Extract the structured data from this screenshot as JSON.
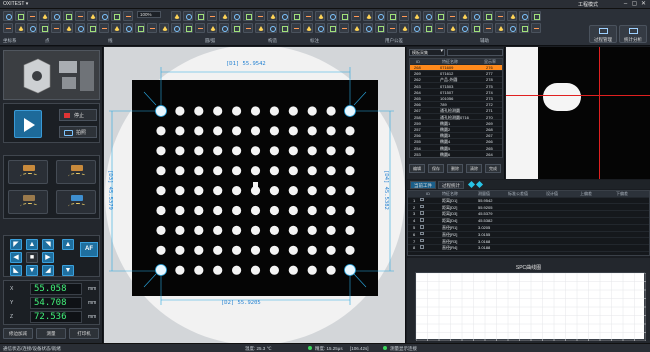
{
  "titlebar": {
    "app_name": "OXITEST ▾",
    "window_title": "工程模式",
    "minimize": "–",
    "maximize": "▢",
    "close": "✕"
  },
  "toolbar": {
    "zoom": "100%",
    "group_labels": [
      "坐标系",
      "点",
      "线",
      "圆/弧",
      "构造",
      "标注",
      "用户公差",
      "辅助"
    ],
    "process_manage": "过程管理",
    "stats_analysis": "统计分析"
  },
  "left": {
    "stop_label": "停止",
    "snapshot_label": "拍照",
    "af_label": "AF",
    "coords": [
      {
        "axis": "X",
        "value": "55.058",
        "unit": "mm"
      },
      {
        "axis": "Y",
        "value": "54.708",
        "unit": "mm"
      },
      {
        "axis": "Z",
        "value": "72.536",
        "unit": "mm"
      }
    ],
    "buttons": [
      "修边加减",
      "测量",
      "打印机"
    ]
  },
  "measurements": {
    "d1": "[D1] 55.9542",
    "d2": "[D2] 55.9205",
    "d3": "[D3] 45.5379",
    "d4": "[D4] 45.5382"
  },
  "list": {
    "combo": "模板采集",
    "headers": [
      "ID",
      "特征名称",
      "显示率"
    ],
    "rows": [
      {
        "id": "268",
        "name": "071609",
        "value": "276",
        "selected": true
      },
      {
        "id": "269",
        "name": "071612",
        "value": "277"
      },
      {
        "id": "262",
        "name": "产品-外圆",
        "value": "278"
      },
      {
        "id": "263",
        "name": "071503",
        "value": "275"
      },
      {
        "id": "264",
        "name": "071507",
        "value": "274"
      },
      {
        "id": "265",
        "name": "101056",
        "value": "273"
      },
      {
        "id": "266",
        "name": "789",
        "value": "272"
      },
      {
        "id": "267",
        "name": "通孔检测圆",
        "value": "271"
      },
      {
        "id": "258",
        "name": "通孔检测圆0716",
        "value": "270"
      },
      {
        "id": "259",
        "name": "椭圆1",
        "value": "269"
      },
      {
        "id": "257",
        "name": "椭圆2",
        "value": "268"
      },
      {
        "id": "256",
        "name": "椭圆3",
        "value": "267"
      },
      {
        "id": "255",
        "name": "椭圆4",
        "value": "266"
      },
      {
        "id": "254",
        "name": "椭圆5",
        "value": "265"
      },
      {
        "id": "253",
        "name": "椭圆6",
        "value": "264"
      }
    ],
    "actions": [
      "编辑",
      "保存",
      "删除",
      "清除",
      "完成"
    ]
  },
  "tabs": {
    "items": [
      "当前工件",
      "过程统计"
    ]
  },
  "results": {
    "headers": [
      "ID",
      "特征名称",
      "测量值",
      "标准公差值",
      "设计值",
      "上偏差",
      "下偏差"
    ],
    "rows": [
      {
        "id": "1",
        "name": "距离[D1]",
        "value": "55.9542"
      },
      {
        "id": "2",
        "name": "距离[D2]",
        "value": "55.9205"
      },
      {
        "id": "3",
        "name": "距离[D3]",
        "value": "45.5379"
      },
      {
        "id": "4",
        "name": "距离[D4]",
        "value": "45.5382"
      },
      {
        "id": "5",
        "name": "直径[R1]",
        "value": "3.0205"
      },
      {
        "id": "6",
        "name": "直径[R2]",
        "value": "3.0155"
      },
      {
        "id": "7",
        "name": "直径[R3]",
        "value": "3.0168"
      },
      {
        "id": "8",
        "name": "直径[R4]",
        "value": "3.0188"
      }
    ]
  },
  "spc": {
    "title": "SPC曲线图"
  },
  "status": {
    "left": "通信状态/连接/设备状态/就绪",
    "temp": "温度: 25.3 ℃",
    "scale": "精度: 15.25μs",
    "pos": "[106.42s]",
    "right": "测量显示连接"
  },
  "colors": {
    "accent": "#1f6f9f",
    "selected_row": "#ff8a1c",
    "coord_green": "#42f07a",
    "dim_line": "#2aa7e0"
  }
}
